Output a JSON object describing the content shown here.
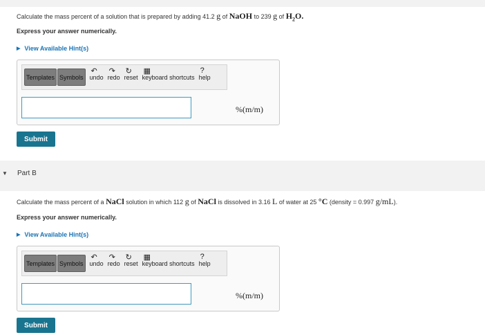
{
  "part_a": {
    "question_prefix": "Calculate the mass percent of a solution that is prepared by adding 41.2",
    "unit_g1": "g",
    "question_mid1": "of",
    "formula1": "NaOH",
    "question_mid2": "to 239",
    "unit_g2": "g",
    "question_mid3": "of",
    "formula2_base": "H",
    "formula2_sub": "2",
    "formula2_end": "O.",
    "instruction": "Express your answer numerically.",
    "hint_label": "View Available Hint(s)",
    "toolbar": {
      "templates": "Templates",
      "symbols": "Symbols",
      "undo": "undo",
      "redo": "redo",
      "reset": "reset",
      "keyboard": "keyboard shortcuts",
      "help": "help"
    },
    "answer_value": "",
    "units": "%(m/m)",
    "submit_label": "Submit"
  },
  "part_b": {
    "label": "Part B",
    "question_prefix": "Calculate the mass percent of a",
    "formula1": "NaCl",
    "question_mid1": "solution in which 112",
    "unit_g": "g",
    "question_mid2": "of",
    "formula2": "NaCl",
    "question_mid3": "is dissolved in 3.16",
    "unit_L": "L",
    "question_mid4": "of water at 25",
    "unit_C": "°C",
    "question_mid5": "(density = 0.997",
    "unit_density": "g/mL",
    "question_end": ").",
    "instruction": "Express your answer numerically.",
    "hint_label": "View Available Hint(s)",
    "toolbar": {
      "templates": "Templates",
      "symbols": "Symbols",
      "undo": "undo",
      "redo": "redo",
      "reset": "reset",
      "keyboard": "keyboard shortcuts",
      "help": "help"
    },
    "answer_value": "",
    "units": "%(m/m)",
    "submit_label": "Submit"
  },
  "icons": {
    "expand_hint": "caret-right-icon",
    "collapse_part": "caret-down-icon",
    "undo": "undo-arrow-icon",
    "redo": "redo-arrow-icon",
    "reset": "reset-icon",
    "keyboard": "keyboard-icon",
    "help": "help-icon"
  },
  "colors": {
    "submit_bg": "#19748f",
    "hint_link": "#1b74b5",
    "input_border": "#3f9abf",
    "section_bg": "#f2f2f2"
  }
}
